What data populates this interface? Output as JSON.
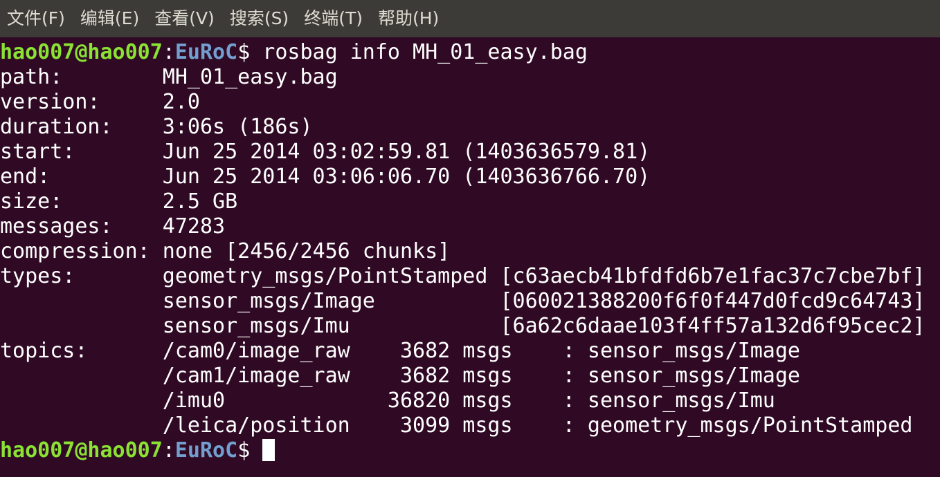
{
  "menu": [
    "文件(F)",
    "编辑(E)",
    "查看(V)",
    "搜索(S)",
    "终端(T)",
    "帮助(H)"
  ],
  "prompt": {
    "userhost": "hao007@hao007",
    "sep": ":",
    "cwd": "EuRoC",
    "symbol": "$"
  },
  "command": " rosbag info MH_01_easy.bag",
  "output": [
    "path:        MH_01_easy.bag",
    "version:     2.0",
    "duration:    3:06s (186s)",
    "start:       Jun 25 2014 03:02:59.81 (1403636579.81)",
    "end:         Jun 25 2014 03:06:06.70 (1403636766.70)",
    "size:        2.5 GB",
    "messages:    47283",
    "compression: none [2456/2456 chunks]",
    "types:       geometry_msgs/PointStamped [c63aecb41bfdfd6b7e1fac37c7cbe7bf]",
    "             sensor_msgs/Image          [060021388200f6f0f447d0fcd9c64743]",
    "             sensor_msgs/Imu            [6a62c6daae103f4ff57a132d6f95cec2]",
    "topics:      /cam0/image_raw    3682 msgs    : sensor_msgs/Image",
    "             /cam1/image_raw    3682 msgs    : sensor_msgs/Image",
    "             /imu0             36820 msgs    : sensor_msgs/Imu",
    "             /leica/position    3099 msgs    : geometry_msgs/PointStamped"
  ],
  "colors": {
    "background": "#300a24",
    "menubar": "#3c3b37",
    "userhost": "#8ae234",
    "cwd": "#729fcf",
    "text": "#ffffff"
  }
}
